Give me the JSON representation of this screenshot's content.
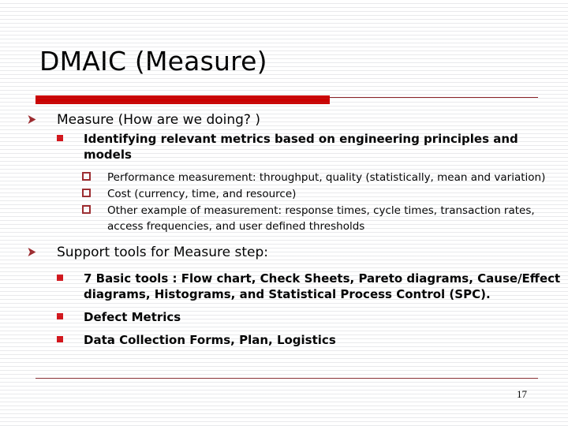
{
  "slide": {
    "title": "DMAIC (Measure)",
    "page_number": "17",
    "colors": {
      "accent_bar": "#CC0000",
      "accent_rule": "#8B2226",
      "bullet_level1": "#9E2A2E",
      "bullet_level2": "#D4151B",
      "bullet_level3": "#9E2A2E",
      "text": "#000000",
      "background": "#FFFFFF"
    },
    "bullets": {
      "level1_icon": "arrow-bullet-icon",
      "level2_icon": "filled-square-bullet-icon",
      "level3_icon": "hollow-square-bullet-icon"
    }
  },
  "sections": [
    {
      "heading": "Measure (How are we doing? )",
      "items": [
        {
          "text": "Identifying relevant metrics based on engineering principles and models",
          "subitems": [
            "Performance measurement: throughput, quality (statistically, mean and variation)",
            "Cost (currency, time, and resource)",
            "Other example of measurement: response times, cycle times, transaction rates, access frequencies, and user defined thresholds"
          ]
        }
      ]
    },
    {
      "heading": "Support tools for Measure step:",
      "items": [
        {
          "text": "7 Basic tools : Flow chart, Check Sheets, Pareto diagrams, Cause/Effect diagrams, Histograms, and Statistical Process Control (SPC).",
          "subitems": []
        },
        {
          "text": "Defect Metrics",
          "subitems": []
        },
        {
          "text": "Data Collection Forms, Plan, Logistics",
          "subitems": []
        }
      ]
    }
  ]
}
